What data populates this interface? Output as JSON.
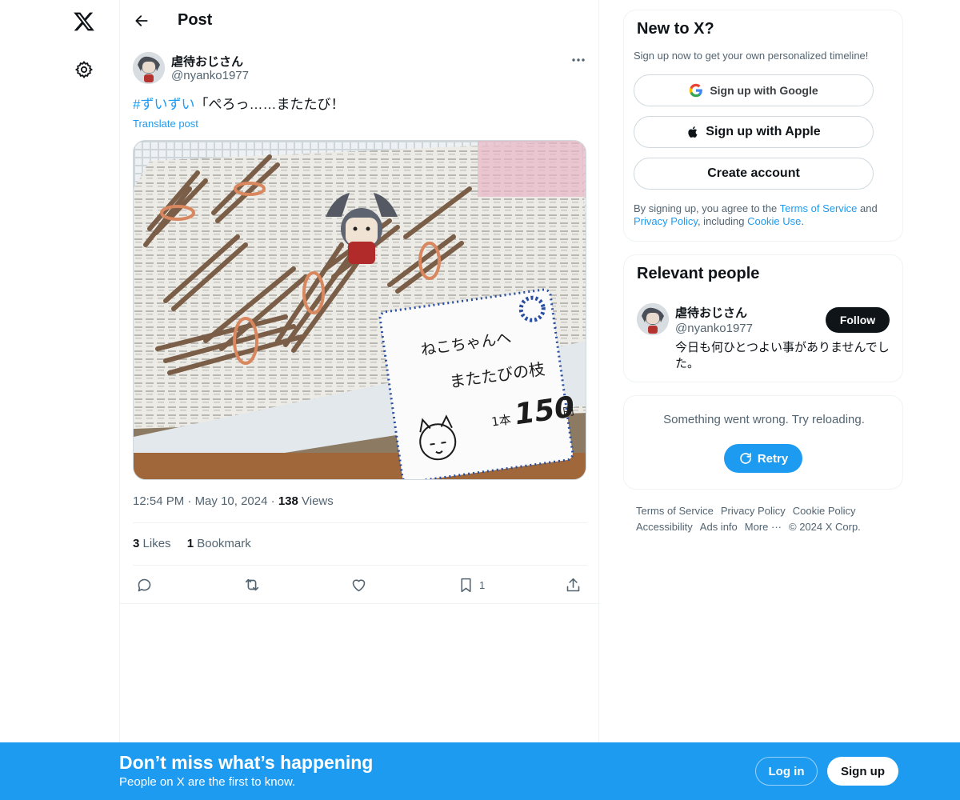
{
  "nav": {
    "logo_icon": "x-logo-icon",
    "settings_icon": "gear-icon"
  },
  "header": {
    "title": "Post"
  },
  "post": {
    "author_name": "虐待おじさん",
    "author_handle": "@nyanko1977",
    "hashtag": "#ずいずい",
    "text": "「ぺろっ……またたび！",
    "translate_label": "Translate post",
    "time": "12:54 PM",
    "date": "May 10, 2024",
    "views_count": "138",
    "views_label": "Views",
    "likes_count": "3",
    "likes_label": "Likes",
    "bookmarks_count": "1",
    "bookmarks_label": "Bookmark",
    "bookmark_action_count": "1",
    "media_sign": {
      "line1": "ねこちゃんへ",
      "line2": "またたびの枝",
      "price_prefix": "1本",
      "price": "150",
      "price_unit": "円"
    }
  },
  "sidebar": {
    "new_to_x": {
      "title": "New to X?",
      "subtitle": "Sign up now to get your own personalized timeline!",
      "google_label": "Sign up with Google",
      "apple_label": "Sign up with Apple",
      "create_label": "Create account",
      "terms_prefix": "By signing up, you agree to the ",
      "terms_link": "Terms of Service",
      "terms_and": " and ",
      "privacy_link": "Privacy Policy",
      "terms_including": ", including ",
      "cookie_link": "Cookie Use",
      "terms_end": "."
    },
    "relevant": {
      "title": "Relevant people",
      "name": "虐待おじさん",
      "handle": "@nyanko1977",
      "follow_label": "Follow",
      "bio": "今日も何ひとつよい事がありませんでした。"
    },
    "error": {
      "message": "Something went wrong. Try reloading.",
      "retry_label": "Retry"
    },
    "footer": [
      "Terms of Service",
      "Privacy Policy",
      "Cookie Policy",
      "Accessibility",
      "Ads info",
      "More ···",
      "© 2024 X Corp."
    ]
  },
  "banner": {
    "title": "Don’t miss what’s happening",
    "subtitle": "People on X are the first to know.",
    "login_label": "Log in",
    "signup_label": "Sign up"
  },
  "colors": {
    "accent": "#1d9bf0",
    "text": "#0f1419",
    "muted": "#536471",
    "border": "#eff3f4"
  }
}
